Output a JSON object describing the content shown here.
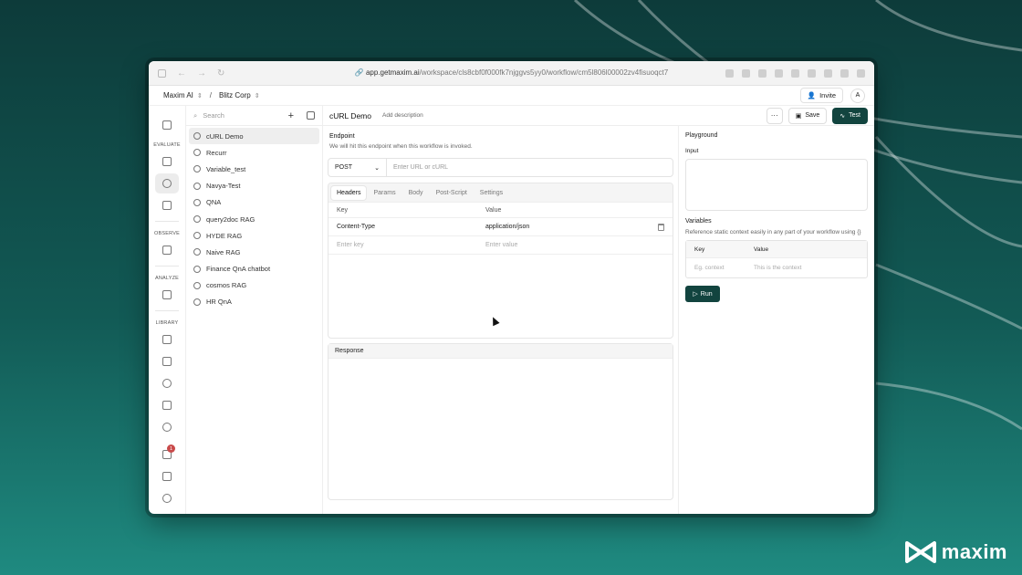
{
  "browser": {
    "url_host": "app.getmaxim.ai",
    "url_path": "/workspace/cls8cbf0f000fk7njggvs5yy0/workflow/cm5l806l00002zv4fisuoqct7"
  },
  "topbar": {
    "org": "Maxim AI",
    "separator": "/",
    "workspace": "Blitz Corp",
    "invite": "Invite",
    "avatar": "A"
  },
  "rail": {
    "sections": [
      "EVALUATE",
      "OBSERVE",
      "ANALYZE",
      "LIBRARY"
    ],
    "badge_count": "1"
  },
  "workflows": {
    "search_placeholder": "Search",
    "items": [
      "cURL Demo",
      "Recurr",
      "Variable_test",
      "Navya-Test",
      "QNA",
      "query2doc RAG",
      "HYDE RAG",
      "Naive RAG",
      "Finance QnA chatbot",
      "cosmos RAG",
      "HR QnA"
    ]
  },
  "editor": {
    "title": "cURL Demo",
    "add_description": "Add description",
    "more": "···",
    "save": "Save",
    "test": "Test",
    "endpoint_title": "Endpoint",
    "endpoint_sub": "We will hit this endpoint when this workflow is invoked.",
    "method": "POST",
    "url_placeholder": "Enter URL or cURL",
    "tabs": [
      "Headers",
      "Params",
      "Body",
      "Post-Script",
      "Settings"
    ],
    "kv_key_header": "Key",
    "kv_value_header": "Value",
    "header_key": "Content-Type",
    "header_value": "application/json",
    "key_placeholder": "Enter key",
    "value_placeholder": "Enter value",
    "response_title": "Response"
  },
  "playground": {
    "title": "Playground",
    "input_label": "Input",
    "variables_title": "Variables",
    "variables_desc": "Reference static context easily in any part of your workflow using {}",
    "var_key_header": "Key",
    "var_value_header": "Value",
    "key_placeholder": "Eg. context",
    "value_placeholder": "This is the context",
    "run": "Run"
  },
  "brand": {
    "name": "maxim"
  },
  "colors": {
    "accent": "#12443f",
    "background_top": "#0d3b3a",
    "background_bottom": "#1f8a80"
  }
}
